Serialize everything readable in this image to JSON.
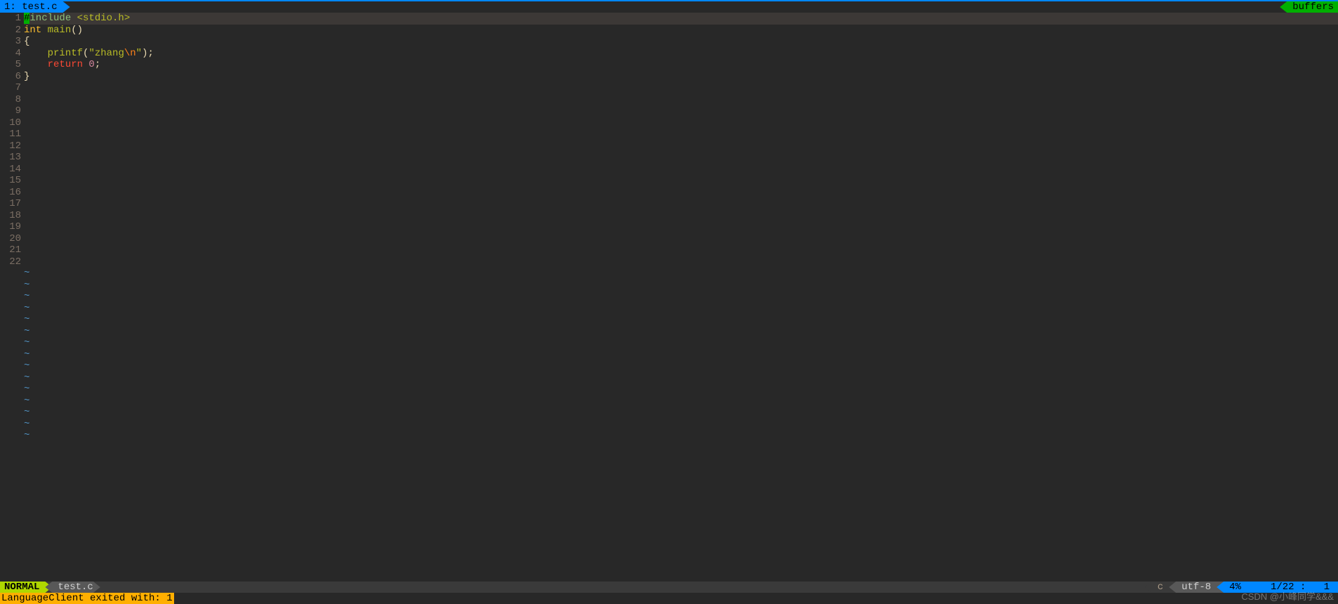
{
  "tabbar": {
    "active_tab": "1: test.c",
    "buffers_label": "buffers"
  },
  "editor": {
    "total_lines": 22,
    "tilde_rows": 15,
    "code": {
      "l1": {
        "hash": "#",
        "include": "include ",
        "header": "<stdio.h>"
      },
      "l2": {
        "type": "int ",
        "func": "main",
        "parens": "()"
      },
      "l3": "{",
      "l4": {
        "indent": "    ",
        "fn": "printf",
        "p1": "(",
        "str1": "\"zhang",
        "esc": "\\n",
        "str2": "\"",
        "p2": ");"
      },
      "l5": {
        "indent": "    ",
        "ret": "return ",
        "num": "0",
        "semi": ";"
      },
      "l6": "}"
    }
  },
  "statusline": {
    "mode": "NORMAL",
    "file": "test.c",
    "filetype": "c",
    "encoding": "utf-8",
    "percent": "4%",
    "line_info": "1/22",
    "sep": " : ",
    "col": "1"
  },
  "cmdline": {
    "message": "LanguageClient exited with: 1"
  },
  "watermark": "CSDN @小峰同学&&&"
}
